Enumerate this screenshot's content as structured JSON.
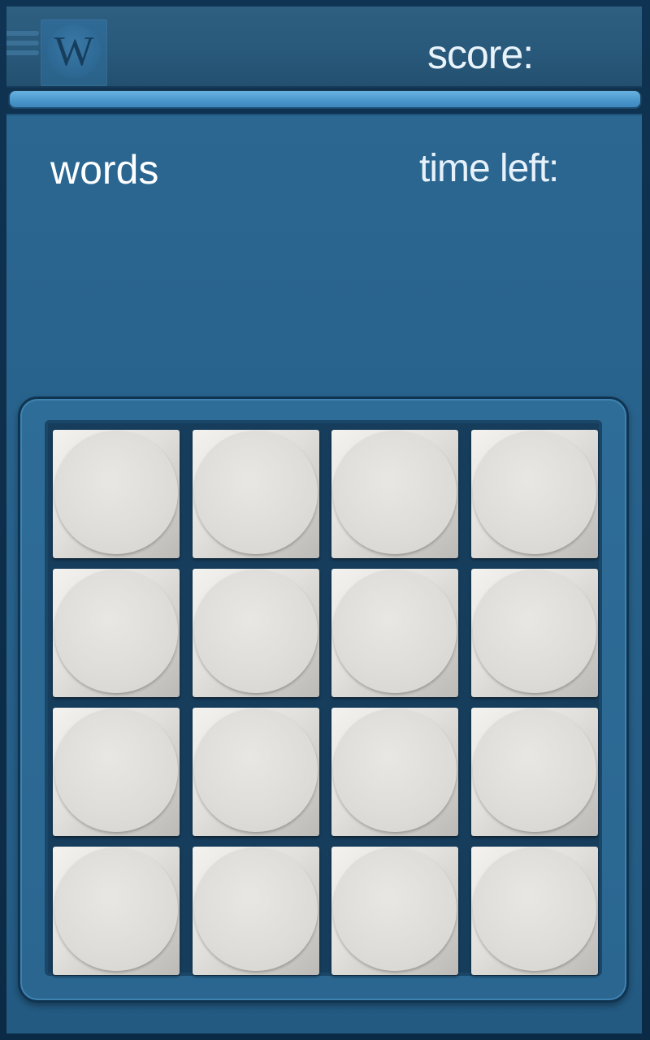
{
  "app": {
    "logo_letter": "W"
  },
  "header": {
    "score_label": "score:"
  },
  "progress": {
    "percent": 100
  },
  "panel": {
    "words_label": "words",
    "time_label": "time left:"
  },
  "board": {
    "rows": 4,
    "cols": 4,
    "tiles": [
      "",
      "",
      "",
      "",
      "",
      "",
      "",
      "",
      "",
      "",
      "",
      "",
      "",
      "",
      "",
      ""
    ]
  },
  "colors": {
    "background": "#0c2740",
    "panel": "#27618b",
    "accent": "#4b98cc",
    "tile": "#e2e0dc"
  },
  "icons": {
    "menu": "menu-lines-icon",
    "logo": "logo-w-icon"
  }
}
